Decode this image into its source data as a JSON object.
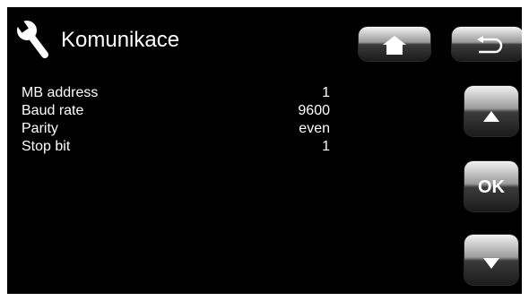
{
  "header": {
    "icon": "wrench-icon",
    "title": "Komunikace"
  },
  "nav": {
    "home_icon": "home-icon",
    "back_icon": "back-arrow-icon",
    "up_icon": "up-arrow-icon",
    "ok_label": "OK",
    "down_icon": "down-arrow-icon"
  },
  "settings": [
    {
      "label": "MB address",
      "value": "1"
    },
    {
      "label": "Baud rate",
      "value": "9600"
    },
    {
      "label": "Parity",
      "value": "even"
    },
    {
      "label": "Stop bit",
      "value": "1"
    }
  ],
  "colors": {
    "background": "#000000",
    "text": "#ffffff",
    "button_top": "#f2f2f2",
    "button_bottom": "#1b1b1b",
    "icon": "#ffffff"
  }
}
